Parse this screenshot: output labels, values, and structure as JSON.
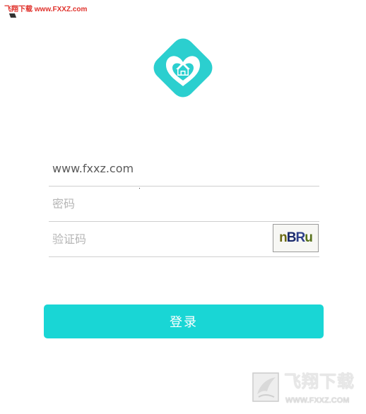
{
  "watermark_top": "飞翔下载 www.FXXZ.com",
  "form": {
    "account_value": "www.fxxz.com",
    "password_placeholder": "密码",
    "captcha_placeholder": "验证码",
    "captcha_chars": [
      "n",
      "B",
      "R",
      "u"
    ]
  },
  "login_button_label": "登录",
  "watermark_bottom": {
    "title": "飞翔下载",
    "url": "WWW.FXXZ.COM"
  },
  "colors": {
    "accent": "#19d6d5",
    "logo": "#2bcfcf",
    "divider": "#cfcfcf"
  },
  "icons": {
    "logo": "heart-home-logo-icon",
    "back": "back-icon",
    "watermark": "watermark-logo-icon"
  }
}
